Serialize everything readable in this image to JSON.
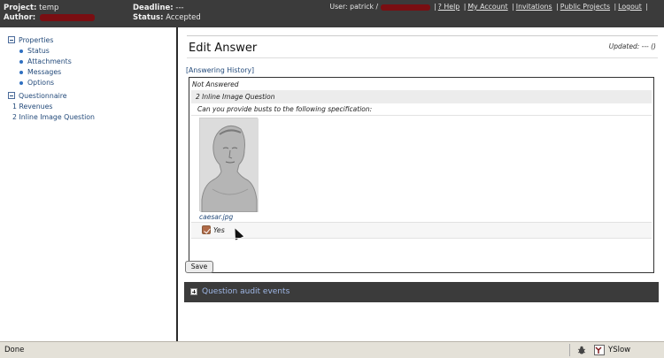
{
  "header": {
    "project_label": "Project:",
    "project_value": "temp",
    "author_label": "Author:",
    "deadline_label": "Deadline:",
    "deadline_value": "---",
    "status_label": "Status:",
    "status_value": "Accepted",
    "user_label": "User: patrick /",
    "links": [
      "? Help",
      "My Account",
      "Invitations",
      "Public Projects",
      "Logout"
    ]
  },
  "sidebar": {
    "properties": "Properties",
    "property_items": [
      "Status",
      "Attachments",
      "Messages",
      "Options"
    ],
    "questionnaire": "Questionnaire",
    "questions": [
      "1 Revenues",
      "2 Inline Image Question"
    ]
  },
  "main": {
    "title": "Edit Answer",
    "updated": "Updated: --- ()",
    "history_link": "[Answering History]",
    "answer_status": "Not Answered",
    "question_heading": "2 Inline Image Question",
    "question_text": "Can you provide busts to the following specification:",
    "image_caption": "caesar.jpg",
    "checkbox_label": "Yes",
    "checkbox_checked": true,
    "save_label": "Save",
    "audit_label": "Question audit events"
  },
  "statusbar": {
    "status_text": "Done",
    "yslow_label": "YSlow"
  },
  "colors": {
    "header_bg": "#3b3b3b",
    "link": "#234a7a",
    "audit_text": "#9fb7e6",
    "redaction": "#7a0e12"
  }
}
